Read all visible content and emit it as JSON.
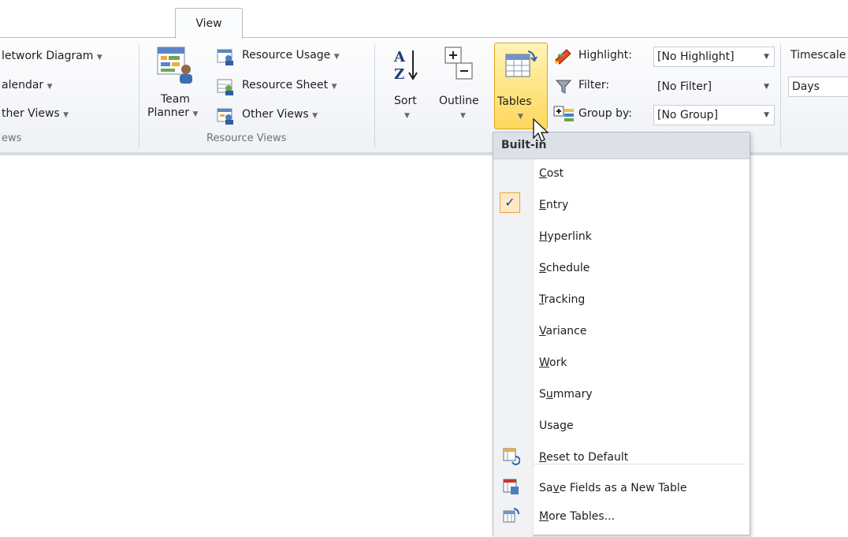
{
  "ribbon": {
    "active_tab": "View",
    "views_group": {
      "network_diagram": "letwork Diagram",
      "calendar": "alendar",
      "other_views": "ther Views",
      "label": "ews"
    },
    "resource_views_group": {
      "team_planner_line1": "Team",
      "team_planner_line2": "Planner",
      "resource_usage": "Resource Usage",
      "resource_sheet": "Resource Sheet",
      "other_views": "Other Views",
      "label": "Resource Views"
    },
    "data_group": {
      "sort": "Sort",
      "outline": "Outline",
      "tables": "Tables",
      "highlight_label": "Highlight:",
      "highlight_value": "[No Highlight]",
      "filter_label": "Filter:",
      "filter_value": "[No Filter]",
      "group_by_label": "Group by:",
      "group_by_value": "[No Group]"
    },
    "timescale_group": {
      "timescale_label": "Timescale",
      "timescale_value": "Days"
    }
  },
  "tables_menu": {
    "header": "Built-in",
    "checked_item": "Entry",
    "items": [
      {
        "pre": "",
        "key": "C",
        "post": "ost"
      },
      {
        "pre": "",
        "key": "E",
        "post": "ntry"
      },
      {
        "pre": "",
        "key": "H",
        "post": "yperlink"
      },
      {
        "pre": "",
        "key": "S",
        "post": "chedule"
      },
      {
        "pre": "",
        "key": "T",
        "post": "racking"
      },
      {
        "pre": "",
        "key": "V",
        "post": "ariance"
      },
      {
        "pre": "",
        "key": "W",
        "post": "ork"
      },
      {
        "pre": "S",
        "key": "u",
        "post": "mmary"
      },
      {
        "pre": "Usa",
        "key": "g",
        "post": "e"
      }
    ],
    "commands": [
      {
        "pre": "",
        "key": "R",
        "post": "eset to Default",
        "icon": "reset-table-icon"
      },
      {
        "pre": "Sa",
        "key": "v",
        "post": "e Fields as a New Table",
        "icon": "save-table-icon"
      },
      {
        "pre": "",
        "key": "M",
        "post": "ore Tables...",
        "icon": "more-tables-icon"
      }
    ]
  }
}
